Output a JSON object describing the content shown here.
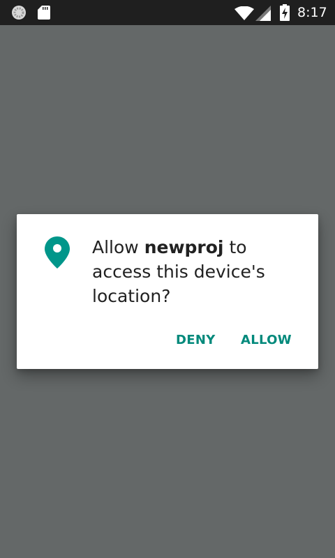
{
  "status_bar": {
    "time": "8:17",
    "icons": [
      "loading-icon",
      "sd-card-icon",
      "wifi-icon",
      "signal-icon",
      "battery-charging-icon"
    ],
    "color": "#1f1f1f"
  },
  "scrim": {
    "color": "#646868"
  },
  "permission_dialog": {
    "message_prefix": "Allow ",
    "app_name": "newproj",
    "message_suffix": " to access this device's location?",
    "icon": "location-pin-icon",
    "accent_color": "#00897b",
    "deny_label": "DENY",
    "allow_label": "ALLOW"
  }
}
